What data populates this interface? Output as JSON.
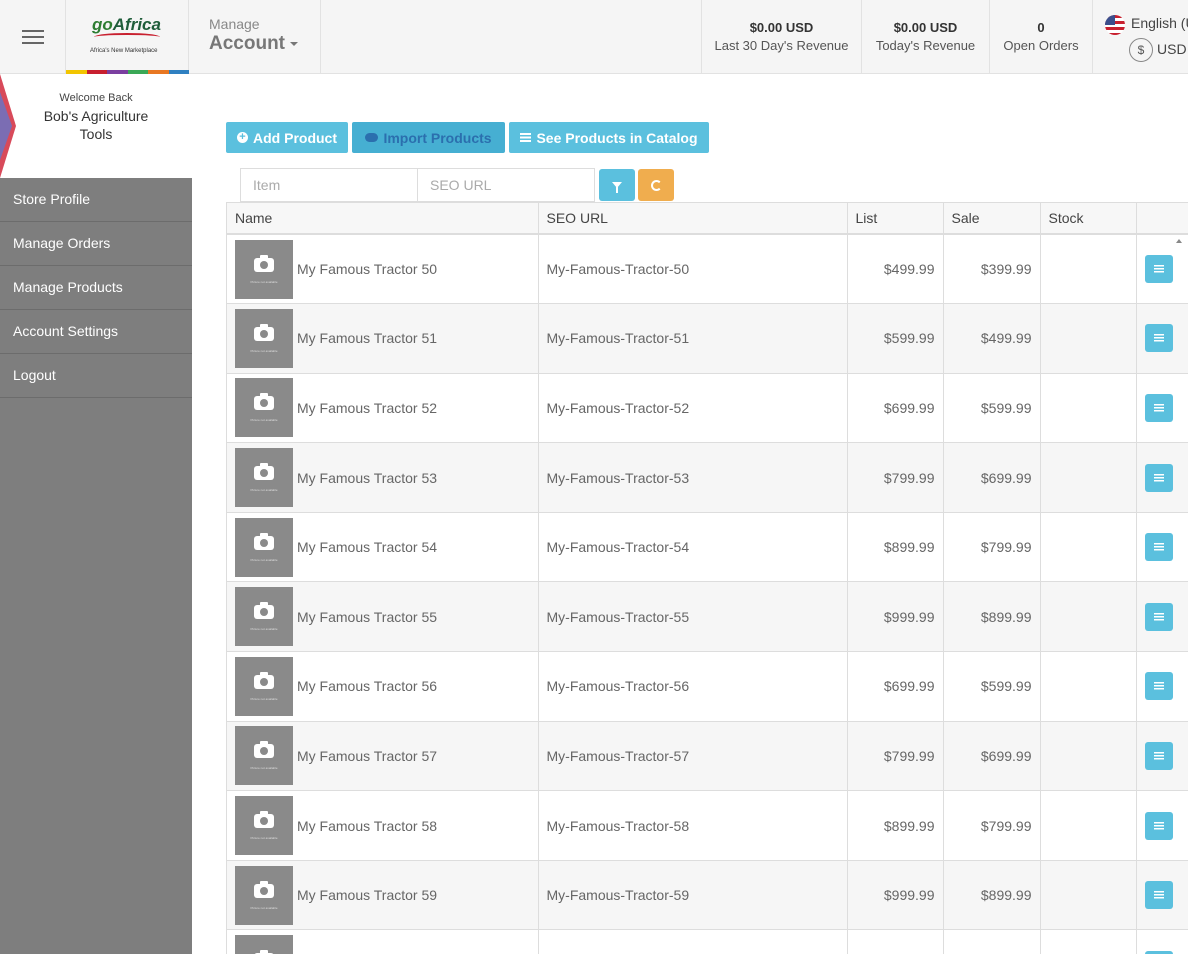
{
  "colors": {
    "accent": "#5bc0de",
    "warning": "#f0ad4e",
    "sidebar": "#7e7e7e"
  },
  "header": {
    "logo_go": "go",
    "logo_africa": "Africa",
    "logo_tagline": "Africa's New Marketplace",
    "manage": "Manage",
    "account": "Account",
    "stats": [
      {
        "value": "$0.00 USD",
        "label": "Last 30 Day's Revenue"
      },
      {
        "value": "$0.00 USD",
        "label": "Today's Revenue"
      },
      {
        "value": "0",
        "label": "Open Orders"
      }
    ],
    "language": "English (U",
    "currency_symbol": "$",
    "currency": "USD"
  },
  "sidebar": {
    "welcome": "Welcome Back",
    "store_name": "Bob's Agriculture Tools",
    "items": [
      {
        "label": "Store Profile"
      },
      {
        "label": "Manage Orders"
      },
      {
        "label": "Manage Products"
      },
      {
        "label": "Account Settings"
      },
      {
        "label": "Logout"
      }
    ]
  },
  "toolbar": {
    "add_product": "Add Product",
    "import_products": "Import Products",
    "see_catalog": "See Products in Catalog"
  },
  "filters": {
    "item_placeholder": "Item",
    "seo_placeholder": "SEO URL"
  },
  "table": {
    "columns": [
      "Name",
      "SEO URL",
      "List",
      "Sale",
      "Stock",
      ""
    ],
    "thumb_text": "Picture not available",
    "rows": [
      {
        "name": "My Famous Tractor 50",
        "seo": "My-Famous-Tractor-50",
        "list": "$499.99",
        "sale": "$399.99",
        "stock": ""
      },
      {
        "name": "My Famous Tractor 51",
        "seo": "My-Famous-Tractor-51",
        "list": "$599.99",
        "sale": "$499.99",
        "stock": ""
      },
      {
        "name": "My Famous Tractor 52",
        "seo": "My-Famous-Tractor-52",
        "list": "$699.99",
        "sale": "$599.99",
        "stock": ""
      },
      {
        "name": "My Famous Tractor 53",
        "seo": "My-Famous-Tractor-53",
        "list": "$799.99",
        "sale": "$699.99",
        "stock": ""
      },
      {
        "name": "My Famous Tractor 54",
        "seo": "My-Famous-Tractor-54",
        "list": "$899.99",
        "sale": "$799.99",
        "stock": ""
      },
      {
        "name": "My Famous Tractor 55",
        "seo": "My-Famous-Tractor-55",
        "list": "$999.99",
        "sale": "$899.99",
        "stock": ""
      },
      {
        "name": "My Famous Tractor 56",
        "seo": "My-Famous-Tractor-56",
        "list": "$699.99",
        "sale": "$599.99",
        "stock": ""
      },
      {
        "name": "My Famous Tractor 57",
        "seo": "My-Famous-Tractor-57",
        "list": "$799.99",
        "sale": "$699.99",
        "stock": ""
      },
      {
        "name": "My Famous Tractor 58",
        "seo": "My-Famous-Tractor-58",
        "list": "$899.99",
        "sale": "$799.99",
        "stock": ""
      },
      {
        "name": "My Famous Tractor 59",
        "seo": "My-Famous-Tractor-59",
        "list": "$999.99",
        "sale": "$899.99",
        "stock": ""
      },
      {
        "name": "",
        "seo": "",
        "list": "",
        "sale": "",
        "stock": ""
      }
    ]
  }
}
